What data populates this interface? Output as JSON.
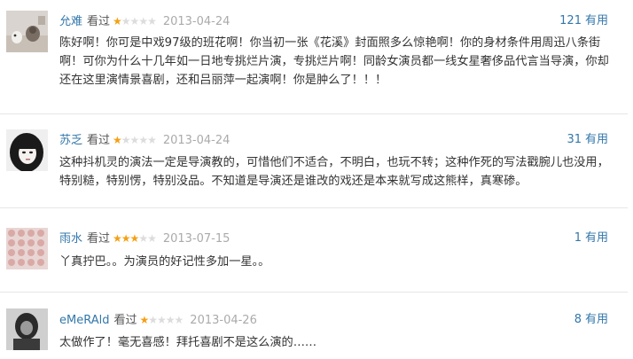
{
  "reviews": [
    {
      "user": "允难",
      "watched": "看过",
      "rating": 1,
      "max_rating": 5,
      "date": "2013-04-24",
      "useful_count": "121",
      "useful_label": "有用",
      "content": "陈好啊！你可是中戏97级的班花啊！你当初一张《花溪》封面照多么惊艳啊！你的身材条件用周迅八条街啊！可你为什么十几年如一日地专挑烂片演，专挑烂片啊！同龄女演员都一线女星奢侈品代言当导演，你却还在这里演情景喜剧，还和吕丽萍一起演啊！你是肿么了！！！"
    },
    {
      "user": "苏乏",
      "watched": "看过",
      "rating": 1,
      "max_rating": 5,
      "date": "2013-04-24",
      "useful_count": "31",
      "useful_label": "有用",
      "content": "这种抖机灵的演法一定是导演教的，可惜他们不适合，不明白，也玩不转；这种作死的写法戳腕儿也没用，特别糙，特别愣，特别没品。不知道是导演还是谁改的戏还是本来就写成这熊样，真寒碜。"
    },
    {
      "user": "雨水",
      "watched": "看过",
      "rating": 3,
      "max_rating": 5,
      "date": "2013-07-15",
      "useful_count": "1",
      "useful_label": "有用",
      "content": "丫真拧巴。。为演员的好记性多加一星。。"
    },
    {
      "user": "eMeRAld",
      "watched": "看过",
      "rating": 1,
      "max_rating": 5,
      "date": "2013-04-26",
      "useful_count": "8",
      "useful_label": "有用",
      "content": "太做作了！毫无喜感！拜托喜剧不是这么演的……"
    }
  ],
  "colors": {
    "link": "#3377aa",
    "star_on": "#f4a015",
    "star_off": "#dcdcdc",
    "date": "#aaaaaa",
    "text": "#333333",
    "separator": "#e6e6e6"
  }
}
